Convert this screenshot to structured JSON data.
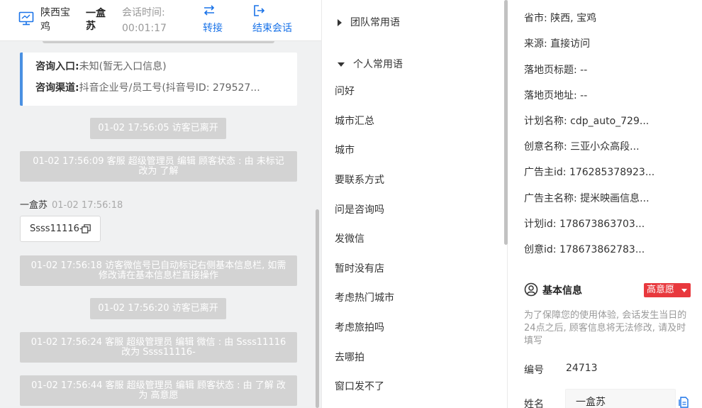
{
  "header": {
    "location": "陕西宝鸡",
    "visitor_name": "一盒苏",
    "time_label": "会话时间:",
    "time_value": "00:01:17",
    "transfer_label": "转接",
    "end_label": "结束会话",
    "accent": "#1a73e8"
  },
  "entry_card": {
    "entry_label": "咨询入口:",
    "entry_value": "未知(暂无入口信息)",
    "channel_label": "咨询渠道:",
    "channel_value": "抖音企业号/员工号(抖音号ID: 279527..."
  },
  "chat": {
    "system_messages": [
      "01-02 17:56:05 访客已离开",
      "01-02 17:56:09 客服 超级管理员 编辑 顾客状态 : 由 未标记 改为 了解",
      "01-02 17:56:18 访客微信号已自动标记右侧基本信息栏, 如需修改请在基本信息栏直接操作",
      "01-02 17:56:20 访客已离开",
      "01-02 17:56:24 客服 超级管理员 编辑 微信 : 由 Ssss11116 改为 Ssss11116-",
      "01-02 17:56:44 客服 超级管理员 编辑 顾客状态 : 由 了解 改为 高意愿"
    ],
    "message": {
      "sender": "一盒苏",
      "time": "01-02 17:56:18",
      "text": "Ssss11116-"
    }
  },
  "phrases": {
    "team_group": "团队常用语",
    "personal_group": "个人常用语",
    "items": [
      "问好",
      "城市汇总",
      "城市",
      "要联系方式",
      "问是咨询吗",
      "发微信",
      "暂时没有店",
      "考虑热门城市",
      "考虑旅拍吗",
      "去哪拍",
      "窗口发不了"
    ]
  },
  "info": {
    "fields": [
      "省市: 陕西, 宝鸡",
      "来源: 直接访问",
      "落地页标题: --",
      "落地页地址: --",
      "计划名称: cdp_auto_729...",
      "创意名称: 三亚小众高段...",
      "广告主id: 176285378923...",
      "广告主名称: 提米映画信息...",
      "计划id: 178673863703...",
      "创意id: 178673862783..."
    ],
    "basic_title": "基本信息",
    "intent_badge": "高意愿",
    "intent_color": "#e8383d",
    "notice": "为了保障您的使用体验, 会话发生当日的24点之后, 顾客信息将无法修改, 请及时填写",
    "number_label": "编号",
    "number_value": "24713",
    "name_label": "姓名",
    "name_value": "一盒苏"
  }
}
